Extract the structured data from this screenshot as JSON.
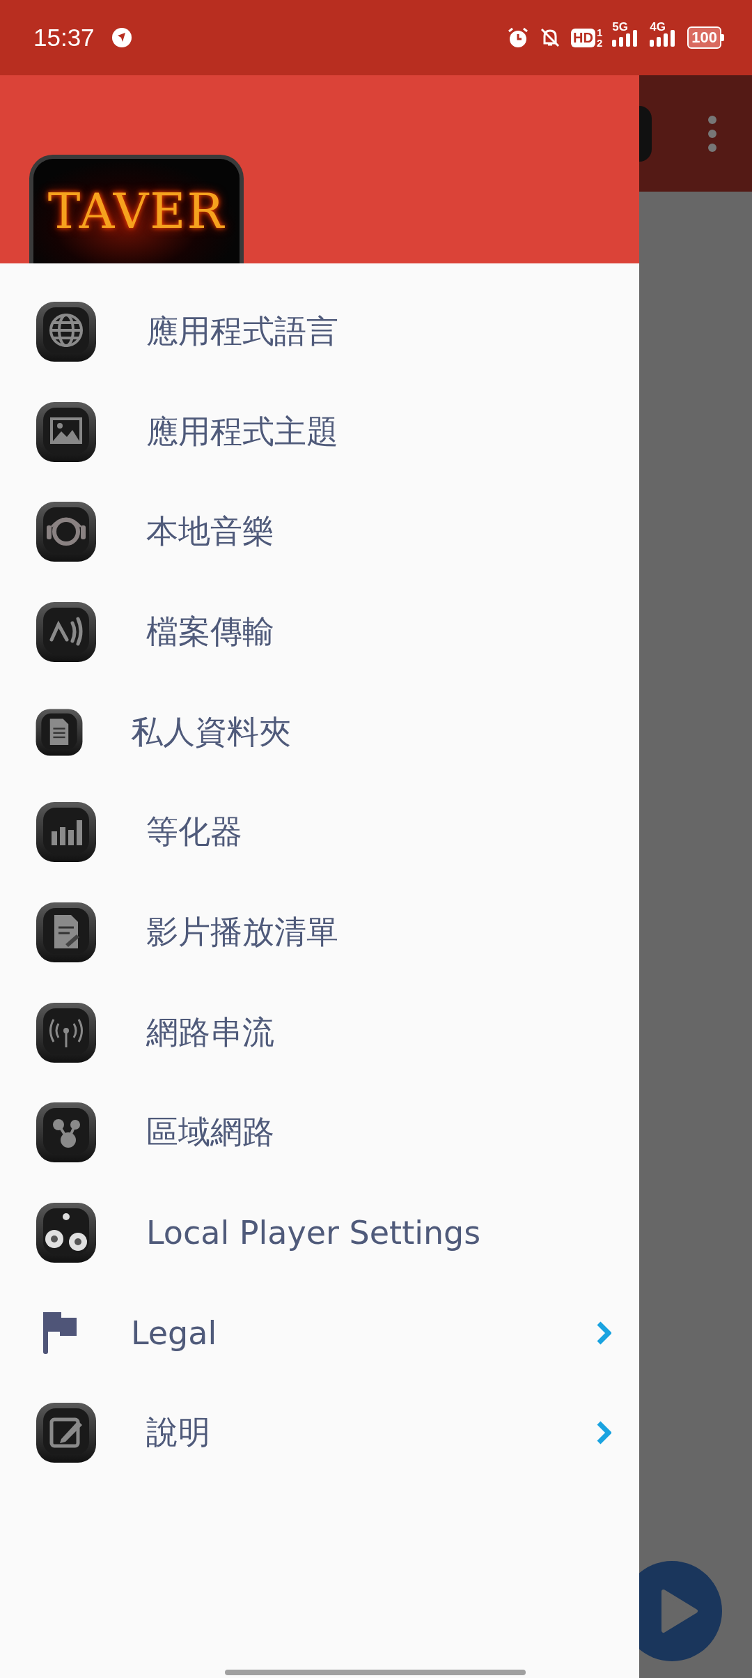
{
  "status_bar": {
    "time": "15:37",
    "hd_label": "HD",
    "sim_slots": [
      "1",
      "2"
    ],
    "networks": [
      {
        "label": "5G"
      },
      {
        "label": "4G"
      }
    ],
    "battery": "100"
  },
  "drawer": {
    "logo_text": "TAVER",
    "items": [
      {
        "label": "應用程式語言",
        "submenu": false
      },
      {
        "label": "應用程式主題",
        "submenu": false
      },
      {
        "label": "本地音樂",
        "submenu": false
      },
      {
        "label": "檔案傳輸",
        "submenu": false
      },
      {
        "label": "私人資料夾",
        "submenu": false
      },
      {
        "label": "等化器",
        "submenu": false
      },
      {
        "label": "影片播放清單",
        "submenu": false
      },
      {
        "label": "網路串流",
        "submenu": false
      },
      {
        "label": "區域網路",
        "submenu": false
      },
      {
        "label": "Local Player Settings",
        "submenu": false
      },
      {
        "label": "Legal",
        "submenu": true
      },
      {
        "label": "說明",
        "submenu": true
      }
    ]
  }
}
